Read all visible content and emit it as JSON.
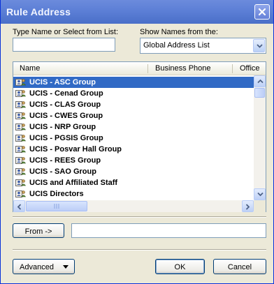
{
  "window": {
    "title": "Rule Address"
  },
  "search": {
    "label": "Type Name or Select from List:",
    "value": ""
  },
  "names_from": {
    "label": "Show Names from the:",
    "selected": "Global Address List"
  },
  "list": {
    "columns": [
      "Name",
      "Business Phone",
      "Office"
    ],
    "rows": [
      {
        "name": "UCIS - ASC Group",
        "selected": true
      },
      {
        "name": "UCIS - Cenad Group"
      },
      {
        "name": "UCIS - CLAS Group"
      },
      {
        "name": "UCIS - CWES Group"
      },
      {
        "name": "UCIS - NRP Group"
      },
      {
        "name": "UCIS - PGSIS Group"
      },
      {
        "name": "UCIS - Posvar Hall Group"
      },
      {
        "name": "UCIS - REES Group"
      },
      {
        "name": "UCIS - SAO Group"
      },
      {
        "name": "UCIS and Affiliated Staff"
      },
      {
        "name": "UCIS Directors"
      }
    ]
  },
  "from_field": {
    "button_label": "From ->",
    "value": ""
  },
  "footer": {
    "advanced_label": "Advanced",
    "ok_label": "OK",
    "cancel_label": "Cancel"
  },
  "colors": {
    "selection": "#316AC5",
    "titlebar": "#5C7FD6"
  }
}
